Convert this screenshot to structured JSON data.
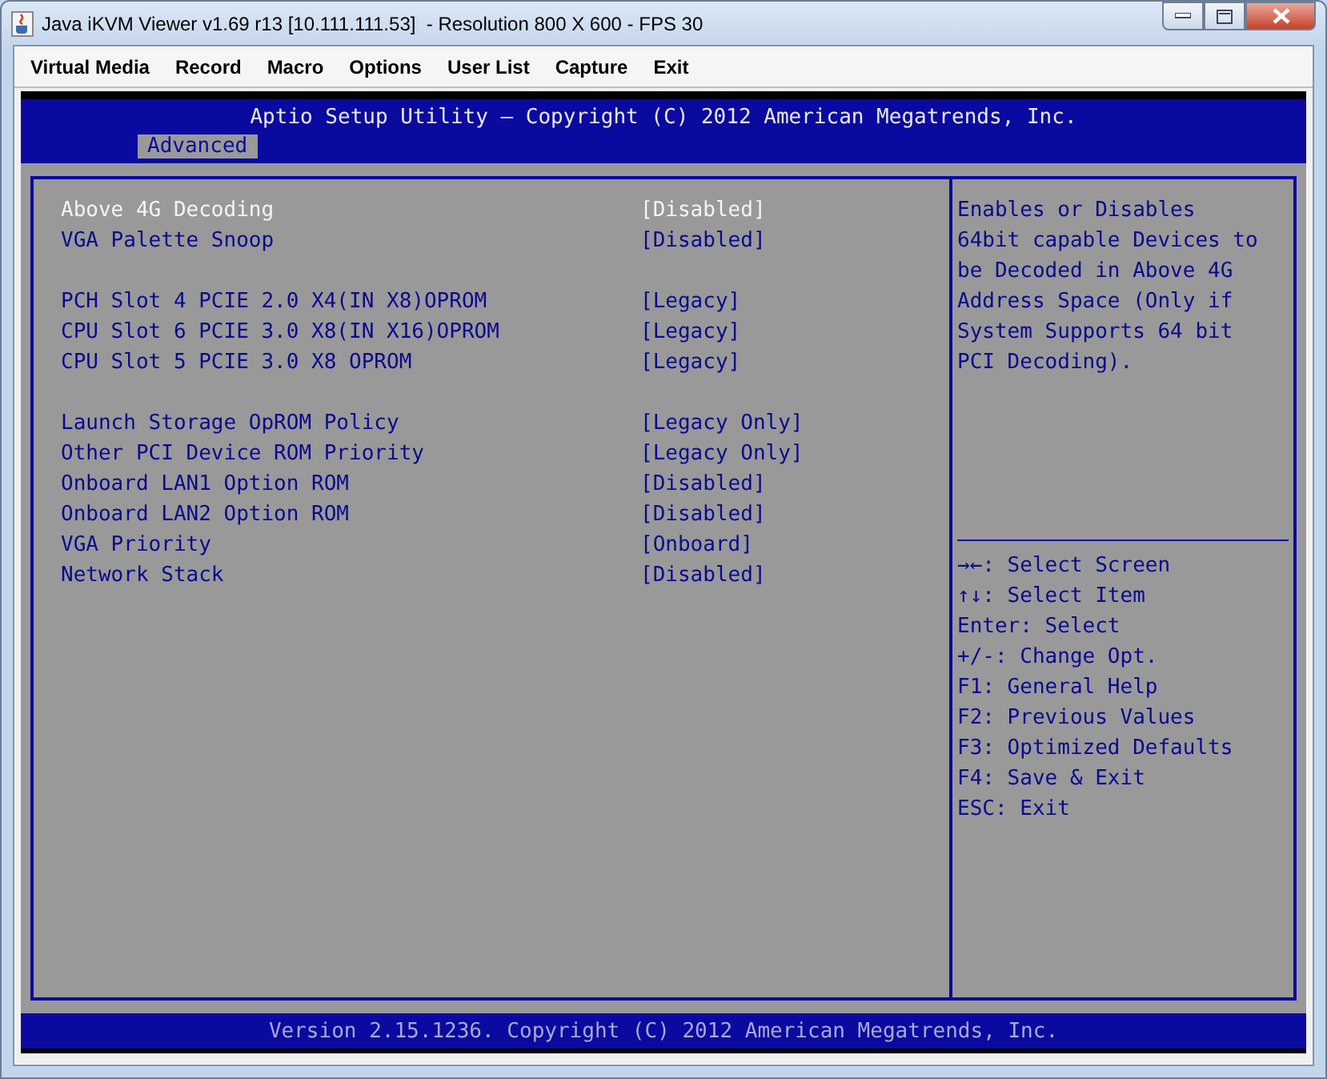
{
  "window": {
    "title": "Java iKVM Viewer v1.69 r13 [10.111.111.53]  - Resolution 800 X 600 - FPS 30"
  },
  "menu": [
    "Virtual Media",
    "Record",
    "Macro",
    "Options",
    "User List",
    "Capture",
    "Exit"
  ],
  "bios": {
    "header": "Aptio Setup Utility – Copyright (C) 2012 American Megatrends, Inc.",
    "tabs": [
      {
        "label": "Advanced",
        "selected": true
      }
    ],
    "groups": [
      [
        {
          "name": "Above 4G Decoding",
          "value": "[Disabled]",
          "selected": true
        },
        {
          "name": "VGA Palette Snoop",
          "value": "[Disabled]",
          "selected": false
        }
      ],
      [
        {
          "name": "PCH Slot 4 PCIE 2.0 X4(IN X8)OPROM",
          "value": "[Legacy]",
          "selected": false
        },
        {
          "name": "CPU Slot 6 PCIE 3.0 X8(IN X16)OPROM",
          "value": "[Legacy]",
          "selected": false
        },
        {
          "name": "CPU Slot 5 PCIE 3.0 X8 OPROM",
          "value": "[Legacy]",
          "selected": false
        }
      ],
      [
        {
          "name": "Launch Storage OpROM Policy",
          "value": "[Legacy Only]",
          "selected": false
        },
        {
          "name": "Other PCI Device ROM Priority",
          "value": "[Legacy Only]",
          "selected": false
        },
        {
          "name": "Onboard LAN1 Option ROM",
          "value": "[Disabled]",
          "selected": false
        },
        {
          "name": "Onboard LAN2 Option ROM",
          "value": "[Disabled]",
          "selected": false
        },
        {
          "name": "VGA Priority",
          "value": "[Onboard]",
          "selected": false
        },
        {
          "name": "Network Stack",
          "value": "[Disabled]",
          "selected": false
        }
      ]
    ],
    "help_text": "Enables or Disables 64bit capable Devices to be Decoded in Above 4G Address Space (Only if System Supports 64 bit PCI Decoding).",
    "key_legend": [
      "→←: Select Screen",
      "↑↓: Select Item",
      "Enter: Select",
      "+/-: Change Opt.",
      "F1: General Help",
      "F2: Previous Values",
      "F3: Optimized Defaults",
      "F4: Save & Exit",
      "ESC: Exit"
    ],
    "footer": "Version 2.15.1236. Copyright (C) 2012 American Megatrends, Inc."
  }
}
